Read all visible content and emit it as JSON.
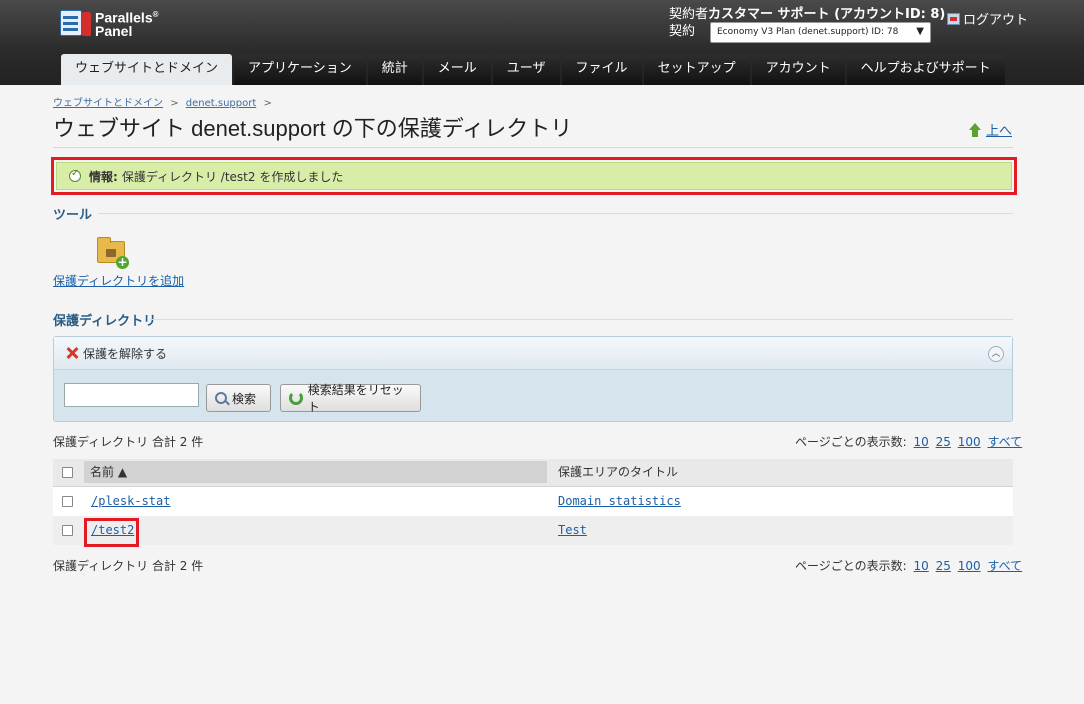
{
  "header": {
    "logo_line1": "Parallels",
    "logo_sup": "®",
    "logo_line2": "Panel",
    "account_label": "契約者",
    "account_name": "カスタマー サポート (アカウントID: 8)",
    "plan_label": "契約",
    "plan_value": "Economy V3 Plan (denet.support) ID: 78",
    "logout_label": "ログアウト"
  },
  "tabs": [
    {
      "label": "ウェブサイトとドメイン",
      "active": true
    },
    {
      "label": "アプリケーション"
    },
    {
      "label": "統計"
    },
    {
      "label": "メール"
    },
    {
      "label": "ユーザ"
    },
    {
      "label": "ファイル"
    },
    {
      "label": "セットアップ"
    },
    {
      "label": "アカウント"
    },
    {
      "label": "ヘルプおよびサポート"
    }
  ],
  "breadcrumb": [
    "ウェブサイトとドメイン",
    "denet.support"
  ],
  "breadcrumb_sep": ">",
  "page_title": "ウェブサイト denet.support の下の保護ディレクトリ",
  "up_link": "上へ",
  "info": {
    "label": "情報:",
    "message": "保護ディレクトリ /test2 を作成しました"
  },
  "tools": {
    "section_title": "ツール",
    "add_label": "保護ディレクトリを追加"
  },
  "protected": {
    "section_title": "保護ディレクトリ",
    "remove_label": "保護を解除する",
    "search_value": "",
    "search_button": "検索",
    "reset_button": "検索結果をリセット",
    "total": "保護ディレクトリ 合計 2 件",
    "per_page_label": "ページごとの表示数:",
    "per_page_options": [
      "10",
      "25",
      "100",
      "すべて"
    ],
    "columns": [
      "名前 ▲",
      "保護エリアのタイトル"
    ],
    "rows": [
      {
        "name": "/plesk-stat",
        "title": "Domain statistics"
      },
      {
        "name": "/test2",
        "title": "Test"
      }
    ]
  },
  "colors": {
    "highlight": "#e41b23",
    "info_bg": "#d8eea8",
    "link": "#1a5fa8"
  }
}
